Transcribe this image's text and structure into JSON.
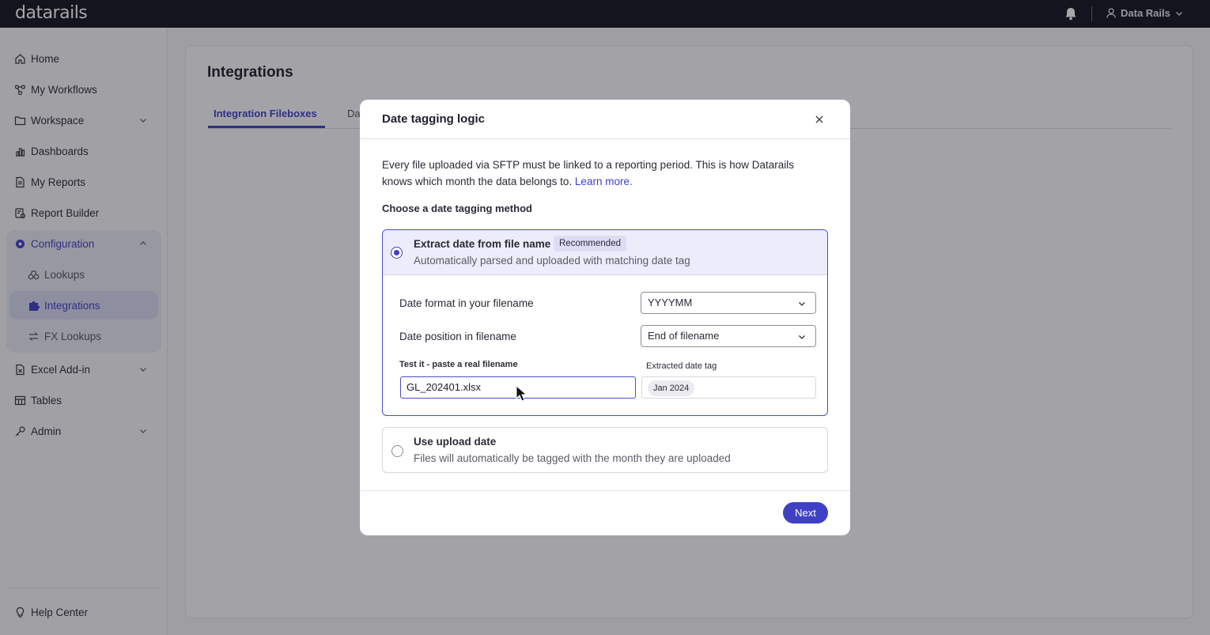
{
  "topbar": {
    "logo": "datarails",
    "user_name": "Data Rails"
  },
  "sidebar": {
    "items": [
      {
        "label": "Home",
        "icon": "home-icon"
      },
      {
        "label": "My Workflows",
        "icon": "workflow-icon"
      },
      {
        "label": "Workspace",
        "icon": "folder-icon"
      },
      {
        "label": "Dashboards",
        "icon": "chart-icon"
      },
      {
        "label": "My Reports",
        "icon": "document-icon"
      },
      {
        "label": "Report Builder",
        "icon": "report-builder-icon"
      },
      {
        "label": "Configuration",
        "icon": "gear-icon"
      },
      {
        "label": "Lookups",
        "icon": "binoculars-icon"
      },
      {
        "label": "Integrations",
        "icon": "puzzle-icon"
      },
      {
        "label": "FX Lookups",
        "icon": "exchange-icon"
      },
      {
        "label": "Excel Add-in",
        "icon": "excel-icon"
      },
      {
        "label": "Tables",
        "icon": "table-icon"
      },
      {
        "label": "Admin",
        "icon": "key-icon"
      }
    ],
    "help": "Help Center"
  },
  "main": {
    "title": "Integrations",
    "tabs": [
      {
        "label": "Integration Fileboxes"
      },
      {
        "label": "Da"
      }
    ]
  },
  "modal": {
    "title": "Date tagging logic",
    "description": "Every file uploaded via SFTP must be linked to a reporting period. This is how Datarails knows which month the data belongs to.",
    "learn_more": "Learn more.",
    "subtitle": "Choose a date tagging method",
    "option1": {
      "title": "Extract date from file name",
      "badge": "Recommended",
      "subtitle": "Automatically parsed and uploaded with matching date tag",
      "format_label": "Date format in your filename",
      "format_value": "YYYYMM",
      "position_label": "Date position in filename",
      "position_value": "End of filename",
      "test_label": "Test it - paste a real filename",
      "test_value": "GL_202401.xlsx",
      "extracted_label": "Extracted date tag",
      "extracted_value": "Jan 2024"
    },
    "option2": {
      "title": "Use upload date",
      "subtitle": "Files will automatically be tagged with the month they are uploaded"
    },
    "next": "Next"
  },
  "colors": {
    "accent": "#3d3fc9",
    "topbar": "#14141f"
  }
}
